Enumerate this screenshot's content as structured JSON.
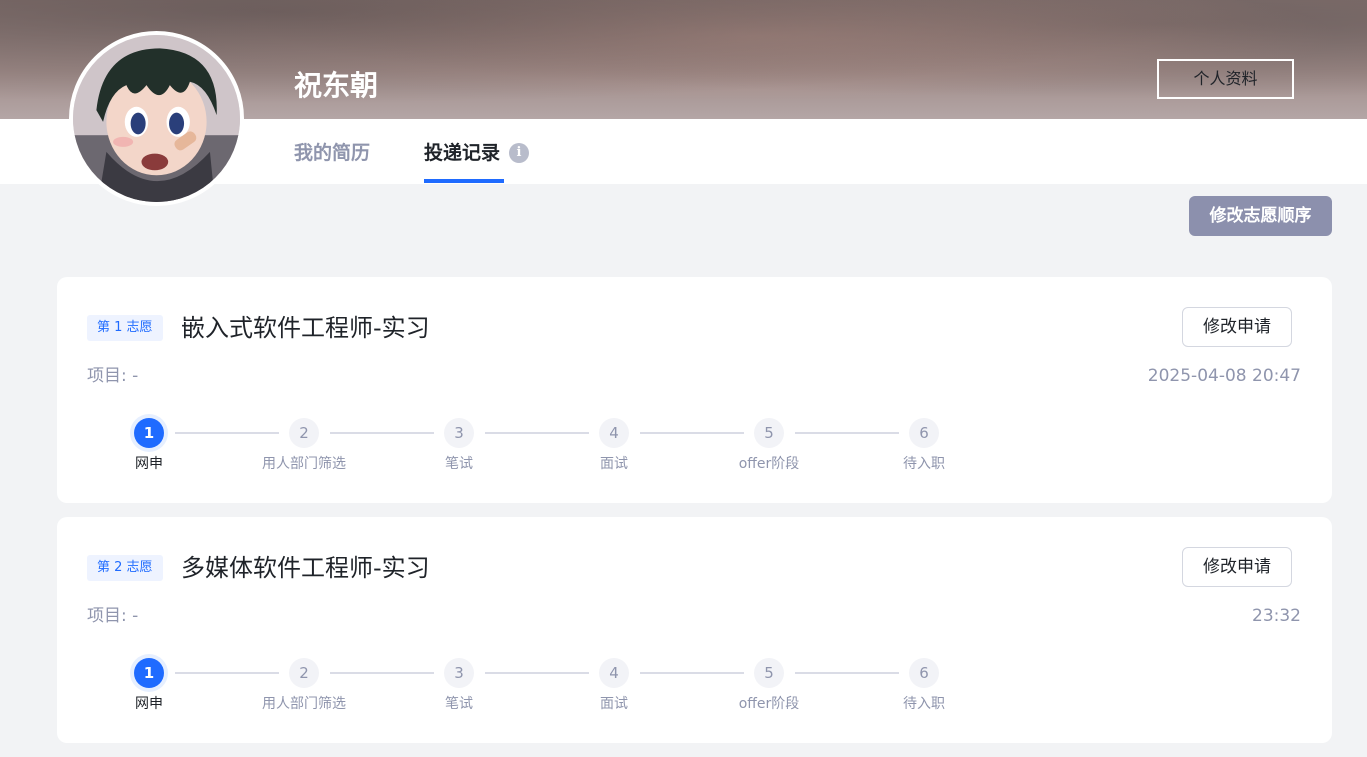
{
  "header": {
    "user_name": "祝东朝",
    "profile_button": "个人资料"
  },
  "tabs": [
    {
      "label": "我的简历",
      "active": false
    },
    {
      "label": "投递记录",
      "active": true
    }
  ],
  "reorder_button": "修改志愿顺序",
  "steps": [
    {
      "number": "1",
      "label": "网申"
    },
    {
      "number": "2",
      "label": "用人部门筛选"
    },
    {
      "number": "3",
      "label": "笔试"
    },
    {
      "number": "4",
      "label": "面试"
    },
    {
      "number": "5",
      "label": "offer阶段"
    },
    {
      "number": "6",
      "label": "待入职"
    }
  ],
  "applications": [
    {
      "badge": "第 1 志愿",
      "title": "嵌入式软件工程师-实习",
      "edit_button": "修改申请",
      "project_label": "项目:",
      "project_value": "-",
      "time": "2025-04-08 20:47",
      "current_step": 1
    },
    {
      "badge": "第 2 志愿",
      "title": "多媒体软件工程师-实习",
      "edit_button": "修改申请",
      "project_label": "项目:",
      "project_value": "-",
      "time": "23:32",
      "current_step": 1
    }
  ],
  "colors": {
    "accent": "#1f6bff",
    "muted": "#8f95ad",
    "reorder_button_bg": "#8c90ad"
  },
  "icons": {
    "info": "info-icon"
  }
}
